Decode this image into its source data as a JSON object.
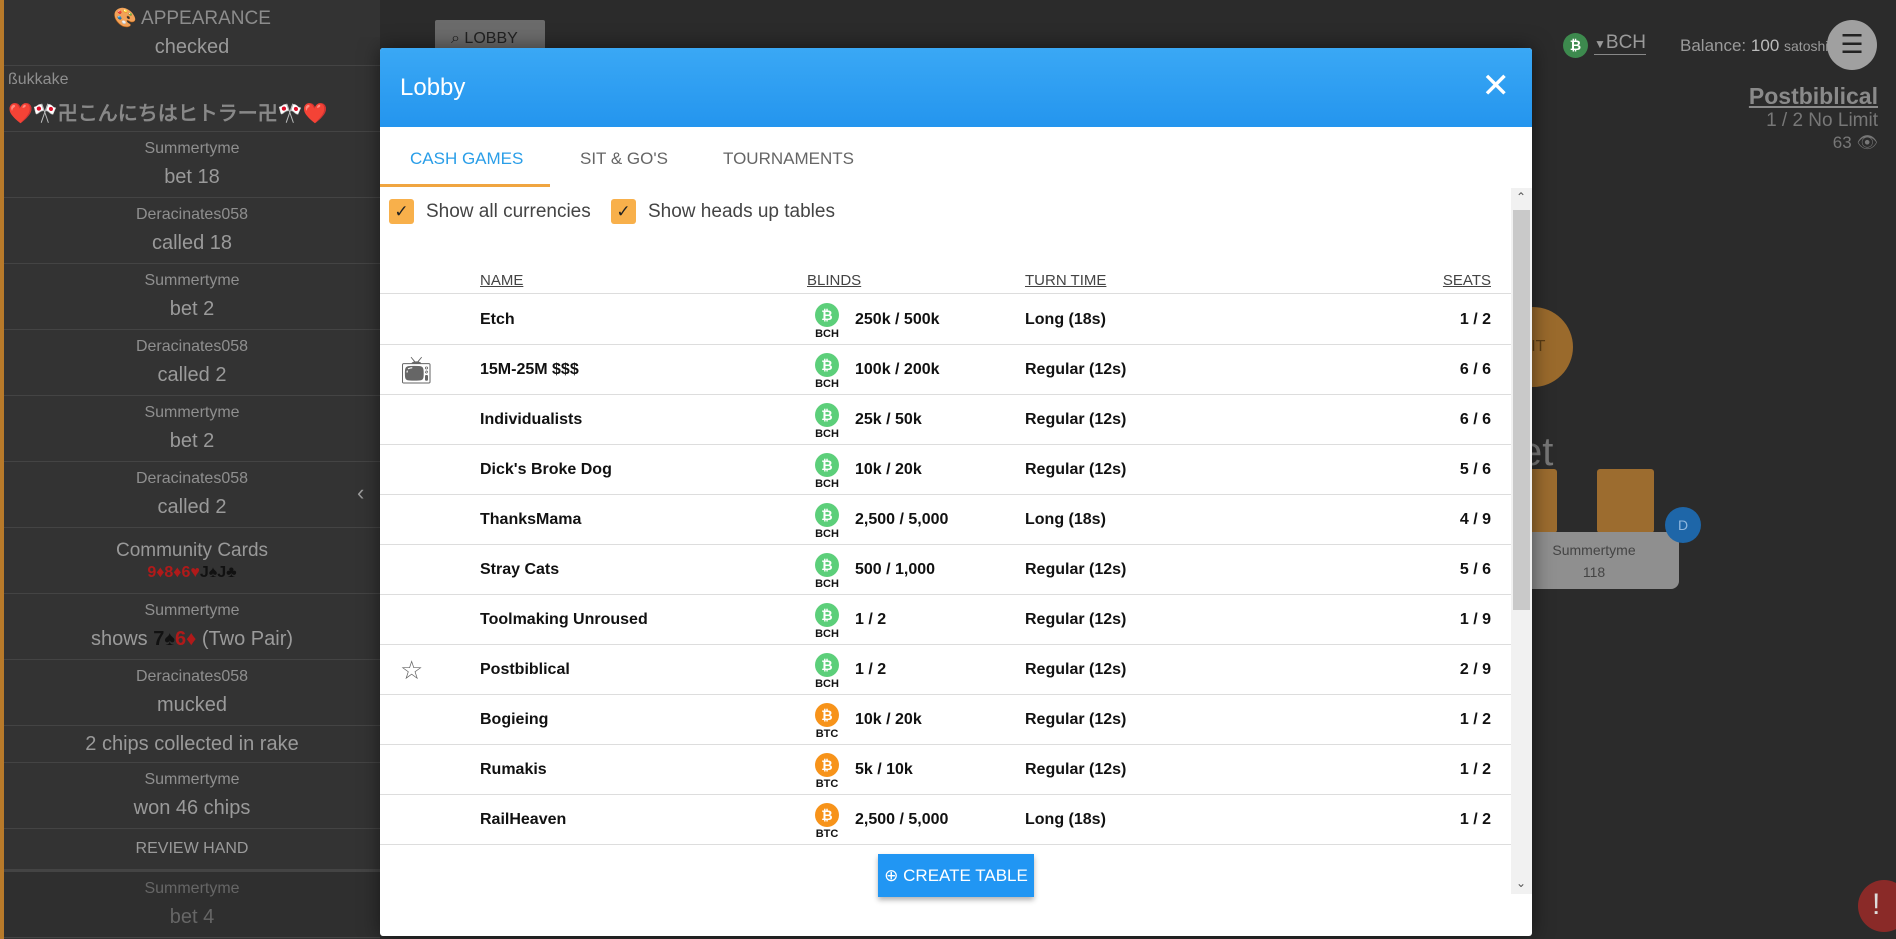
{
  "sidebar": {
    "header": "APPEARANCE",
    "entries": [
      {
        "who": "",
        "act": "checked"
      },
      {
        "who": "ßukkake",
        "act": "❤️🎌卍こんにちはヒトラー卍🎌❤️",
        "style": "left"
      },
      {
        "who": "Summertyme",
        "act": "bet 18"
      },
      {
        "who": "Deracinates058",
        "act": "called 18"
      },
      {
        "who": "Summertyme",
        "act": "bet 2"
      },
      {
        "who": "Deracinates058",
        "act": "called 2"
      },
      {
        "who": "Summertyme",
        "act": "bet 2"
      },
      {
        "who": "Deracinates058",
        "act": "called 2"
      }
    ],
    "community": {
      "title": "Community Cards",
      "cards": [
        {
          "t": "9♦",
          "c": "red"
        },
        {
          "t": "8♦",
          "c": "red"
        },
        {
          "t": "6♥",
          "c": "red"
        },
        {
          "t": "J♠",
          "c": "blk"
        },
        {
          "t": "J♣",
          "c": "blk"
        }
      ]
    },
    "shows": {
      "who": "Summertyme",
      "prefix": "shows",
      "cards": [
        {
          "t": "7♠",
          "c": "blk"
        },
        {
          "t": "6♦",
          "c": "red"
        }
      ],
      "suffix": "(Two Pair)"
    },
    "after": [
      {
        "who": "Deracinates058",
        "act": "mucked"
      },
      {
        "who": "",
        "act": "2 chips collected in rake"
      },
      {
        "who": "Summertyme",
        "act": "won 46 chips"
      }
    ],
    "review": "REVIEW HAND",
    "next": {
      "who": "Summertyme",
      "act": "bet 4"
    }
  },
  "lobby_button": "LOBBY",
  "topbar": {
    "currency": "BCH",
    "balance_label": "Balance:",
    "balance": "100",
    "unit": "satoshis",
    "table_name": "Postbiblical",
    "table_desc": "1 / 2 No Limit",
    "viewers": "63"
  },
  "background": {
    "sit": "SIT",
    "partial_text": "et",
    "player": {
      "name": "Summertyme",
      "chips": "118"
    },
    "dealer": "D",
    "alert": "!"
  },
  "modal": {
    "title": "Lobby",
    "tabs": [
      "CASH GAMES",
      "SIT & GO'S",
      "TOURNAMENTS"
    ],
    "active_tab": 0,
    "filters": [
      {
        "label": "Show all currencies",
        "checked": true
      },
      {
        "label": "Show heads up tables",
        "checked": true
      }
    ],
    "columns": [
      "NAME",
      "BLINDS",
      "TURN TIME",
      "SEATS"
    ],
    "rows": [
      {
        "icon": "",
        "name": "Etch",
        "cur": "BCH",
        "blinds": "250k / 500k",
        "turn": "Long (18s)",
        "seats": "1 / 2"
      },
      {
        "icon": "tv",
        "name": "15M-25M $$$",
        "cur": "BCH",
        "blinds": "100k / 200k",
        "turn": "Regular (12s)",
        "seats": "6 / 6"
      },
      {
        "icon": "",
        "name": "Individualists",
        "cur": "BCH",
        "blinds": "25k / 50k",
        "turn": "Regular (12s)",
        "seats": "6 / 6"
      },
      {
        "icon": "",
        "name": "Dick's Broke Dog",
        "cur": "BCH",
        "blinds": "10k / 20k",
        "turn": "Regular (12s)",
        "seats": "5 / 6"
      },
      {
        "icon": "",
        "name": "ThanksMama",
        "cur": "BCH",
        "blinds": "2,500 / 5,000",
        "turn": "Long (18s)",
        "seats": "4 / 9"
      },
      {
        "icon": "",
        "name": "Stray Cats",
        "cur": "BCH",
        "blinds": "500 / 1,000",
        "turn": "Regular (12s)",
        "seats": "5 / 6"
      },
      {
        "icon": "",
        "name": "Toolmaking Unroused",
        "cur": "BCH",
        "blinds": "1 / 2",
        "turn": "Regular (12s)",
        "seats": "1 / 9"
      },
      {
        "icon": "star",
        "name": "Postbiblical",
        "cur": "BCH",
        "blinds": "1 / 2",
        "turn": "Regular (12s)",
        "seats": "2 / 9"
      },
      {
        "icon": "",
        "name": "Bogieing",
        "cur": "BTC",
        "blinds": "10k / 20k",
        "turn": "Regular (12s)",
        "seats": "1 / 2"
      },
      {
        "icon": "",
        "name": "Rumakis",
        "cur": "BTC",
        "blinds": "5k / 10k",
        "turn": "Regular (12s)",
        "seats": "1 / 2"
      },
      {
        "icon": "",
        "name": "RailHeaven",
        "cur": "BTC",
        "blinds": "2,500 / 5,000",
        "turn": "Long (18s)",
        "seats": "1 / 2"
      }
    ],
    "create": "CREATE TABLE"
  },
  "colors": {
    "BCH": "#5ccf7a",
    "BTC": "#f7931a",
    "accent": "#2196f3",
    "tab_underline": "#f0a540"
  }
}
